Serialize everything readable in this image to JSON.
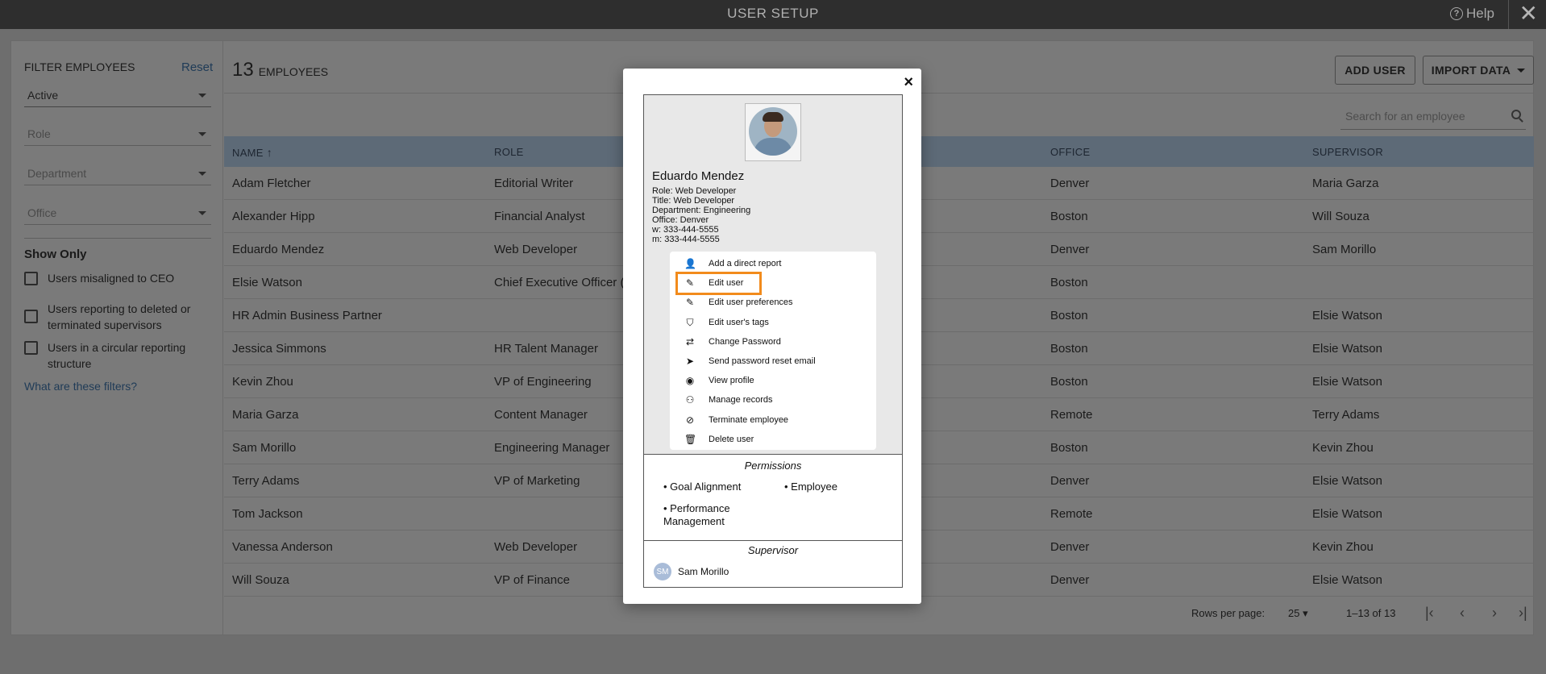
{
  "topbar": {
    "title": "USER SETUP",
    "help": "Help",
    "help_icon": "question-circle-icon",
    "close_glyph": "✕"
  },
  "filters": {
    "title": "FILTER EMPLOYEES",
    "reset": "Reset",
    "status": "Active",
    "role_placeholder": "Role",
    "department_placeholder": "Department",
    "office_placeholder": "Office",
    "show_only": "Show Only",
    "checks": [
      "Users misaligned to CEO",
      "Users reporting to deleted or terminated supervisors",
      "Users in a circular reporting structure"
    ],
    "help_link": "What are these filters?"
  },
  "header": {
    "count": "13",
    "count_label": "EMPLOYEES",
    "add_user": "ADD USER",
    "import_data": "IMPORT DATA",
    "search_placeholder": "Search for an employee"
  },
  "table": {
    "columns": [
      "NAME",
      "ROLE",
      "OFFICE",
      "SUPERVISOR"
    ],
    "rows": [
      [
        "Adam Fletcher",
        "Editorial Writer",
        "Denver",
        "Maria Garza"
      ],
      [
        "Alexander Hipp",
        "Financial Analyst",
        "Boston",
        "Will Souza"
      ],
      [
        "Eduardo Mendez",
        "Web Developer",
        "Denver",
        "Sam Morillo"
      ],
      [
        "Elsie Watson",
        "Chief Executive Officer (C",
        "Boston",
        ""
      ],
      [
        "HR Admin Business Partner",
        "",
        "Boston",
        "Elsie Watson"
      ],
      [
        "Jessica Simmons",
        "HR Talent Manager",
        "Boston",
        "Elsie Watson"
      ],
      [
        "Kevin Zhou",
        "VP of Engineering",
        "Boston",
        "Elsie Watson"
      ],
      [
        "Maria Garza",
        "Content Manager",
        "Remote",
        "Terry Adams"
      ],
      [
        "Sam Morillo",
        "Engineering Manager",
        "Boston",
        "Kevin Zhou"
      ],
      [
        "Terry Adams",
        "VP of Marketing",
        "Denver",
        "Elsie Watson"
      ],
      [
        "Tom Jackson",
        "",
        "Remote",
        "Elsie Watson"
      ],
      [
        "Vanessa Anderson",
        "Web Developer",
        "Denver",
        "Kevin Zhou"
      ],
      [
        "Will Souza",
        "VP of Finance",
        "Denver",
        "Elsie Watson"
      ]
    ]
  },
  "pager": {
    "rows_label": "Rows per page:",
    "rows_value": "25",
    "range": "1–13 of 13"
  },
  "modal": {
    "close": "×",
    "name": "Eduardo Mendez",
    "info": [
      "Role: Web Developer",
      "Title: Web Developer",
      "Department: Engineering",
      "Office: Denver",
      "w: 333-444-5555",
      "m: 333-444-5555"
    ],
    "menu": [
      {
        "icon": "person-icon",
        "glyph": "👤",
        "label": "Add a direct report"
      },
      {
        "icon": "edit-icon",
        "glyph": "✎",
        "label": "Edit user"
      },
      {
        "icon": "edit-icon",
        "glyph": "✎",
        "label": "Edit user preferences"
      },
      {
        "icon": "tags-icon",
        "glyph": "⛉",
        "label": "Edit user's tags"
      },
      {
        "icon": "shuffle-icon",
        "glyph": "⇄",
        "label": "Change Password"
      },
      {
        "icon": "send-icon",
        "glyph": "➤",
        "label": "Send password reset email"
      },
      {
        "icon": "eye-icon",
        "glyph": "◉",
        "label": "View profile"
      },
      {
        "icon": "users-icon",
        "glyph": "⚇",
        "label": "Manage records"
      },
      {
        "icon": "ban-icon",
        "glyph": "⊘",
        "label": "Terminate employee"
      },
      {
        "icon": "trash-icon",
        "glyph": "🗑",
        "label": "Delete user"
      }
    ],
    "permissions_title": "Permissions",
    "permissions": [
      "• Goal Alignment",
      "• Employee",
      "• Performance Management"
    ],
    "supervisor_title": "Supervisor",
    "supervisor_initials": "SM",
    "supervisor_name": "Sam Morillo"
  },
  "colors": {
    "highlight": "#f28b1c",
    "link": "#1f3b57"
  }
}
